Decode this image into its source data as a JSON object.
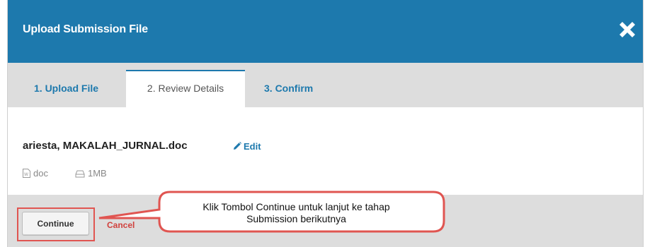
{
  "dialog": {
    "title": "Upload Submission File"
  },
  "tabs": [
    {
      "label": "1. Upload File"
    },
    {
      "label": "2. Review Details"
    },
    {
      "label": "3. Confirm"
    }
  ],
  "file": {
    "name": "ariesta, MAKALAH_JURNAL.doc",
    "edit_label": "Edit",
    "type": "doc",
    "size": "1MB"
  },
  "footer": {
    "continue_label": "Continue",
    "cancel_label": "Cancel"
  },
  "callout": {
    "line1": "Klik Tombol Continue untuk lanjut ke tahap",
    "line2": "Submission berikutnya"
  },
  "colors": {
    "header": "#1d79ad",
    "link": "#1d79ad",
    "cancel": "#d0413d",
    "highlight": "#e05551"
  }
}
